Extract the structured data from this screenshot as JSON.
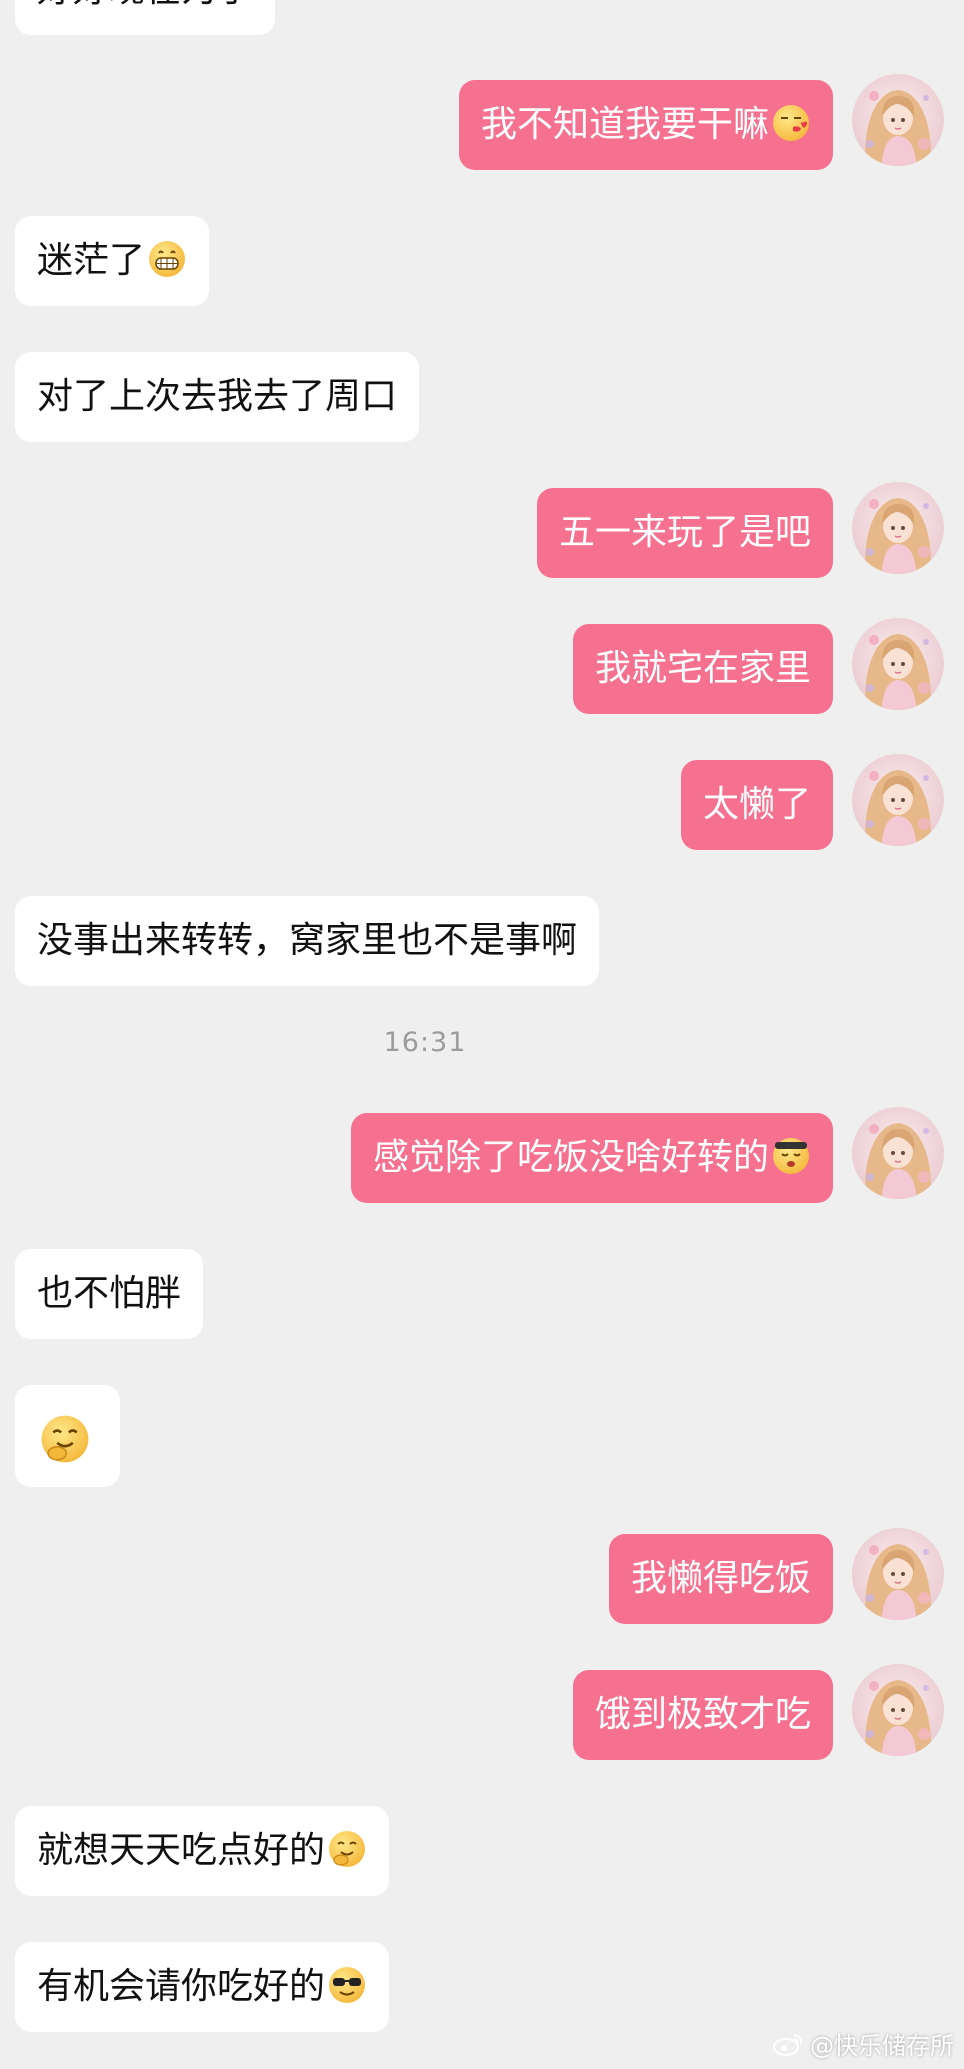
{
  "chat": {
    "messages": [
      {
        "side": "received",
        "text": "好好现在为了",
        "emoji": ""
      },
      {
        "side": "sent",
        "text": "我不知道我要干嘛",
        "emoji": "kiss-emoji"
      },
      {
        "side": "received",
        "text": "迷茫了",
        "emoji": "grin-emoji"
      },
      {
        "side": "received",
        "text": "对了上次去我去了周口",
        "emoji": ""
      },
      {
        "side": "sent",
        "text": "五一来玩了是吧",
        "emoji": ""
      },
      {
        "side": "sent",
        "text": "我就宅在家里",
        "emoji": ""
      },
      {
        "side": "sent",
        "text": "太懒了",
        "emoji": ""
      },
      {
        "side": "received",
        "text": "没事出来转转，窝家里也不是事啊",
        "emoji": ""
      },
      {
        "side": "sent",
        "text": "感觉除了吃饭没啥好转的",
        "emoji": "sleepy-emoji"
      },
      {
        "side": "received",
        "text": "也不怕胖",
        "emoji": ""
      },
      {
        "side": "received",
        "text": "",
        "emoji": "giggle-emoji"
      },
      {
        "side": "sent",
        "text": "我懒得吃饭",
        "emoji": ""
      },
      {
        "side": "sent",
        "text": "饿到极致才吃",
        "emoji": ""
      },
      {
        "side": "received",
        "text": "就想天天吃点好的",
        "emoji": "giggle-emoji"
      },
      {
        "side": "received",
        "text": "有机会请你吃好的",
        "emoji": "sunglasses-emoji"
      }
    ],
    "timestamp": "16:31"
  },
  "watermark": {
    "text": "@快乐储存所",
    "icon": "weibo-icon"
  },
  "colors": {
    "background": "#efefef",
    "sent_bubble": "#f6718f",
    "received_bubble": "#ffffff",
    "timestamp": "#9b9b9b"
  }
}
